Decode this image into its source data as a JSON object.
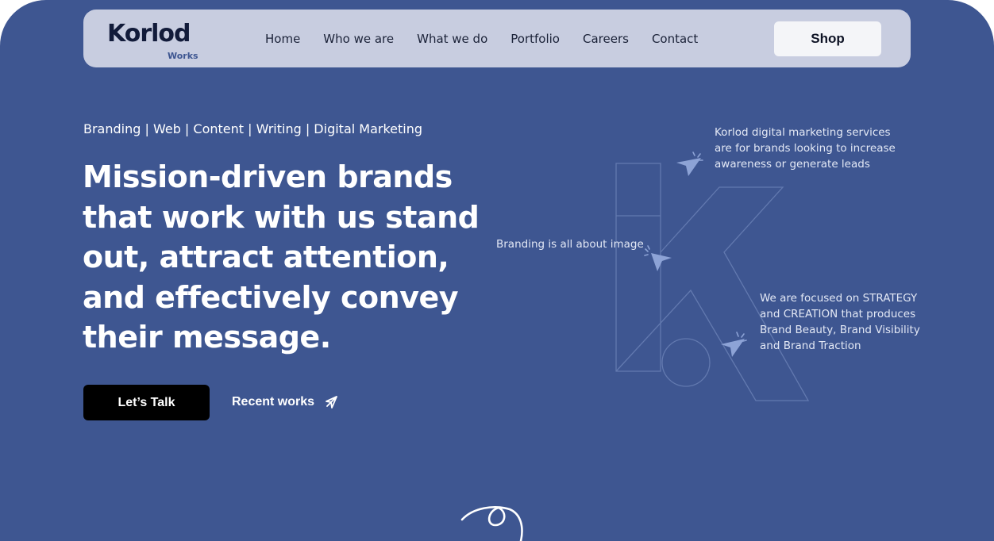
{
  "brand": {
    "logo_initial": "K",
    "logo_rest": "orlod",
    "logo_subtitle": "Works",
    "accent_color": "#3e5691",
    "nav_background": "#c8cde0"
  },
  "nav": {
    "items": [
      {
        "label": "Home"
      },
      {
        "label": "Who we are"
      },
      {
        "label": "What we do"
      },
      {
        "label": "Portfolio"
      },
      {
        "label": "Careers"
      },
      {
        "label": "Contact"
      }
    ],
    "shop_label": "Shop"
  },
  "hero": {
    "services": "Branding | Web | Content | Writing | Digital Marketing",
    "headline": "Mission-driven brands that work with us stand out, attract attention, and effectively convey their message.",
    "cta_primary": "Let’s Talk",
    "cta_secondary": "Recent works",
    "cta_secondary_icon": "send-arrow-icon"
  },
  "callouts": [
    {
      "text": "Korlod digital marketing services are for brands looking to increase awareness or generate leads",
      "icon": "cursor-click-icon"
    },
    {
      "text": "Branding is all about image",
      "icon": "cursor-click-icon"
    },
    {
      "text": "We are focused on STRATEGY and CREATION that produces Brand Beauty, Brand Visibility and Brand Traction",
      "icon": "cursor-click-icon"
    }
  ],
  "decor": {
    "scroll_icon": "scroll-swirl-icon"
  }
}
